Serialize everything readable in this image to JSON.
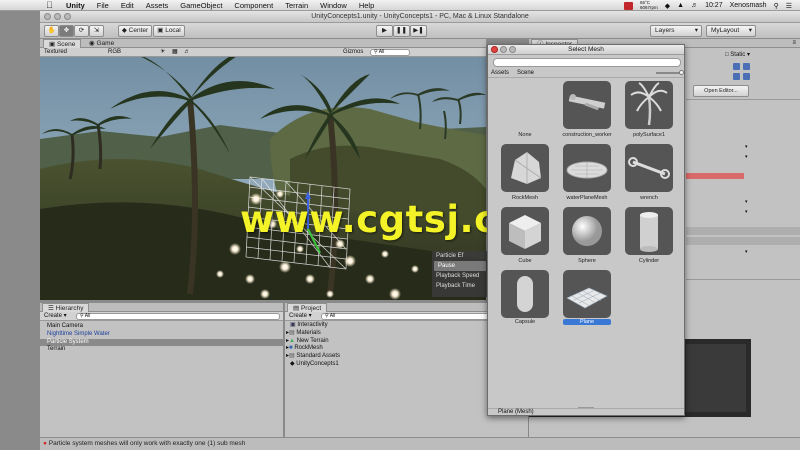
{
  "menubar": {
    "apple": "",
    "app": "Unity",
    "items": [
      "File",
      "Edit",
      "Assets",
      "GameObject",
      "Component",
      "Terrain",
      "Window",
      "Help"
    ],
    "cpu": "65°C",
    "mem": "6067rpm",
    "clock": "10:27",
    "user": "Xenosmash"
  },
  "window": {
    "title": "UnityConcepts1.unity - UnityConcepts1 - PC, Mac & Linux Standalone"
  },
  "toolbar": {
    "center": "Center",
    "local": "Local",
    "layers": "Layers",
    "layout": "MyLayout"
  },
  "scene": {
    "tabs": [
      "Scene",
      "Game"
    ],
    "textured": "Textured",
    "rgb": "RGB",
    "gizmos": "Gizmos",
    "all": "All"
  },
  "particle_popup": {
    "title": "Particle Ef",
    "pause": "Pause",
    "speed": "Playback Speed",
    "time": "Playback Time"
  },
  "hierarchy": {
    "tab": "Hierarchy",
    "create": "Create",
    "all": "All",
    "items": [
      {
        "label": "Main Camera",
        "style": ""
      },
      {
        "label": "Nighttime Simple Water",
        "style": "blue"
      },
      {
        "label": "Particle System",
        "style": "sel"
      },
      {
        "label": "Terrain",
        "style": ""
      }
    ]
  },
  "project": {
    "tab": "Project",
    "create": "Create",
    "all": "All",
    "items": [
      "Interactivity",
      "Materials",
      "New Terrain",
      "RockMesh",
      "Standard Assets",
      "UnityConcepts1"
    ]
  },
  "inspector": {
    "tab": "Inspector",
    "static": "Static",
    "open_editor": "Open Editor..."
  },
  "dialog": {
    "title": "Select Mesh",
    "tabs": [
      "Assets",
      "Scene"
    ],
    "items": [
      "None",
      "construction_worker",
      "polySurface1",
      "RockMesh",
      "waterPlaneMesh",
      "wrench",
      "Cube",
      "Sphere",
      "Cylinder",
      "Capsule",
      "Plane"
    ],
    "selected": "Plane",
    "footer": "Plane (Mesh)"
  },
  "status": {
    "message": "Particle system meshes will only work with exactly one (1) sub mesh"
  },
  "watermark": "www.cgtsj.com",
  "colors": {
    "accent": "#3a78d6",
    "error": "#d22a2a",
    "sky": "#8fb0c8"
  }
}
